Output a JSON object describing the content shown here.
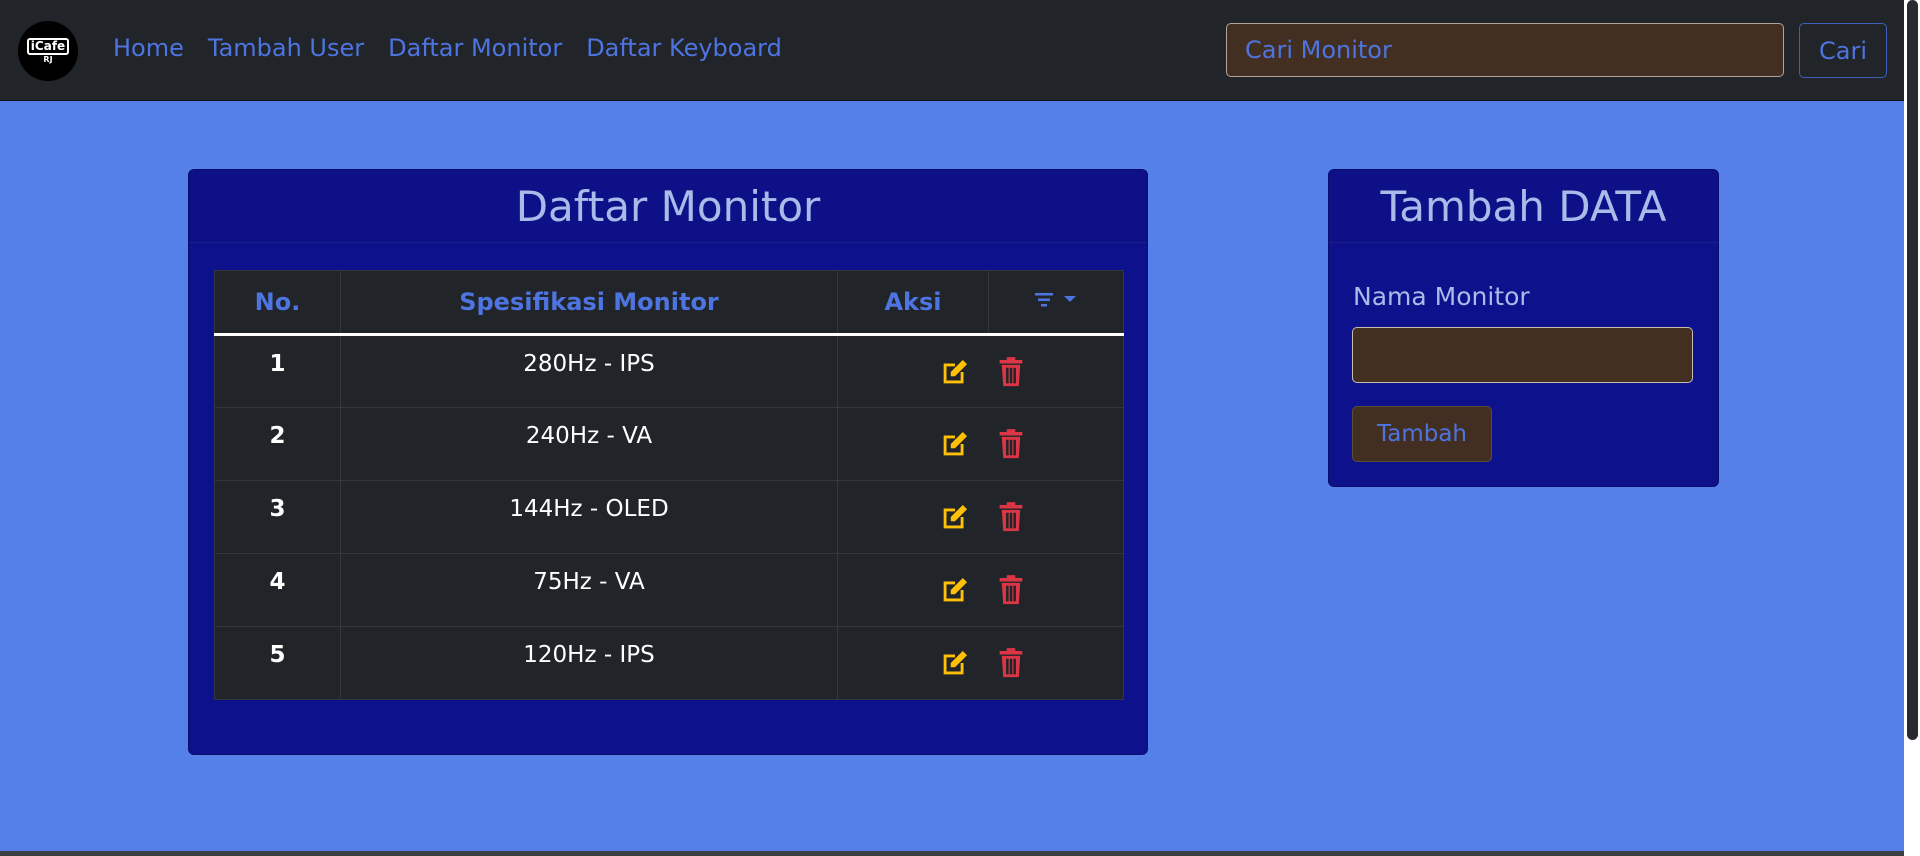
{
  "navbar": {
    "logo_text": "iCafe",
    "logo_sub": "RJ",
    "links": [
      "Home",
      "Tambah User",
      "Daftar Monitor",
      "Daftar Keyboard"
    ],
    "search_placeholder": "Cari Monitor",
    "search_button": "Cari"
  },
  "monitor_card": {
    "title": "Daftar Monitor",
    "columns": [
      "No.",
      "Spesifikasi Monitor",
      "Aksi"
    ],
    "filter_icon": "filter-icon",
    "dropdown_icon": "caret-down-icon",
    "rows": [
      {
        "no": "1",
        "spec": "280Hz - IPS"
      },
      {
        "no": "2",
        "spec": "240Hz - VA"
      },
      {
        "no": "3",
        "spec": "144Hz - OLED"
      },
      {
        "no": "4",
        "spec": "75Hz - VA"
      },
      {
        "no": "5",
        "spec": "120Hz - IPS"
      }
    ],
    "edit_icon": "edit-icon",
    "delete_icon": "trash-icon",
    "colors": {
      "edit": "#ffc107",
      "delete": "#dc3545"
    }
  },
  "add_card": {
    "title": "Tambah DATA",
    "label": "Nama Monitor",
    "input_value": "",
    "button": "Tambah"
  }
}
